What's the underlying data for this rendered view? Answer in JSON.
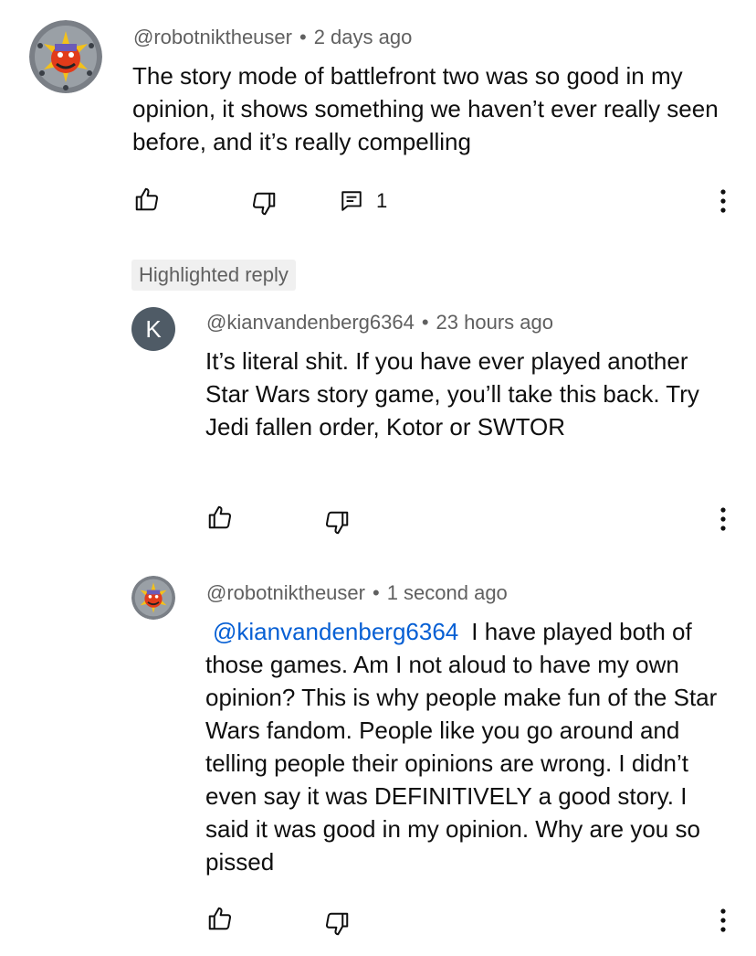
{
  "comments": [
    {
      "author": "@robotniktheuser",
      "time": "2 days ago",
      "text": "The story mode of battlefront two was so good in my opinion, it shows something we haven’t ever really seen before, and it’s really compelling",
      "reply_count": "1"
    }
  ],
  "highlight_label": "Highlighted reply",
  "replies": [
    {
      "avatar_letter": "K",
      "author": "@kianvandenberg6364",
      "time": "23 hours ago",
      "text": "It’s literal shit. If you have ever played another Star Wars story game, you’ll take this back. Try Jedi fallen order, Kotor or SWTOR"
    },
    {
      "author": "@robotniktheuser",
      "time": "1 second ago",
      "mention": "@kianvandenberg6364",
      "text": "I have played both of those games. Am I not aloud to have my own opinion? This is why people make fun of the Star Wars fandom. People like you go around and telling people their opinions are wrong. I didn’t even say it was DEFINITIVELY a good story. I said it was good in my opinion. Why are you so pissed"
    }
  ],
  "icons": {
    "like": "thumbs-up-icon",
    "dislike": "thumbs-down-icon",
    "reply": "comment-icon",
    "more": "more-vertical-icon"
  }
}
